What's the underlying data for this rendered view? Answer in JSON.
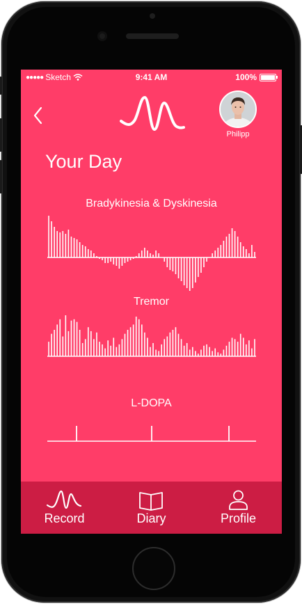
{
  "status_bar": {
    "carrier": "Sketch",
    "time": "9:41 AM",
    "battery": "100%",
    "battery_level": 1.0
  },
  "header": {
    "user_name": "Philipp"
  },
  "title": "Your Day",
  "sections": {
    "bradykinesia": {
      "label": "Bradykinesia & Dyskinesia"
    },
    "tremor": {
      "label": "Tremor"
    },
    "ldopa": {
      "label": "L-DOPA"
    }
  },
  "chart_data": [
    {
      "type": "bar",
      "title": "Bradykinesia & Dyskinesia",
      "values": [
        60,
        52,
        44,
        38,
        36,
        38,
        34,
        40,
        30,
        28,
        26,
        22,
        18,
        16,
        12,
        10,
        6,
        2,
        -2,
        -4,
        -8,
        -8,
        -6,
        -10,
        -12,
        -16,
        -12,
        -8,
        -6,
        -4,
        -2,
        2,
        6,
        10,
        14,
        10,
        6,
        4,
        10,
        6,
        0,
        -6,
        -14,
        -18,
        -20,
        -24,
        -30,
        -34,
        -40,
        -44,
        -48,
        -44,
        -36,
        -28,
        -22,
        -14,
        -6,
        0,
        6,
        10,
        14,
        18,
        24,
        30,
        34,
        42,
        38,
        30,
        22,
        16,
        12,
        6,
        18,
        8
      ],
      "ylim": [
        -50,
        60
      ]
    },
    {
      "type": "bar",
      "title": "Tremor",
      "values": [
        22,
        34,
        40,
        48,
        56,
        30,
        62,
        38,
        54,
        56,
        52,
        40,
        20,
        26,
        44,
        38,
        26,
        36,
        22,
        18,
        12,
        24,
        16,
        28,
        14,
        18,
        26,
        34,
        40,
        44,
        48,
        60,
        56,
        48,
        36,
        28,
        14,
        20,
        10,
        8,
        18,
        26,
        30,
        36,
        40,
        44,
        34,
        26,
        16,
        20,
        10,
        14,
        8,
        4,
        10,
        16,
        18,
        14,
        8,
        12,
        6,
        4,
        10,
        16,
        22,
        28,
        26,
        22,
        34,
        28,
        18,
        24,
        12,
        26
      ],
      "ylim": [
        0,
        64
      ]
    },
    {
      "type": "bar",
      "title": "L-DOPA",
      "x": [
        0.14,
        0.5,
        0.87
      ],
      "values": [
        1,
        1,
        1
      ]
    }
  ],
  "tabs": [
    {
      "label": "Record",
      "icon": "wave-icon",
      "active": true
    },
    {
      "label": "Diary",
      "icon": "book-icon",
      "active": false
    },
    {
      "label": "Profile",
      "icon": "person-icon",
      "active": false
    }
  ],
  "colors": {
    "background": "#ff3d68",
    "tabbar": "#cc1d44",
    "foreground": "#ffffff"
  }
}
